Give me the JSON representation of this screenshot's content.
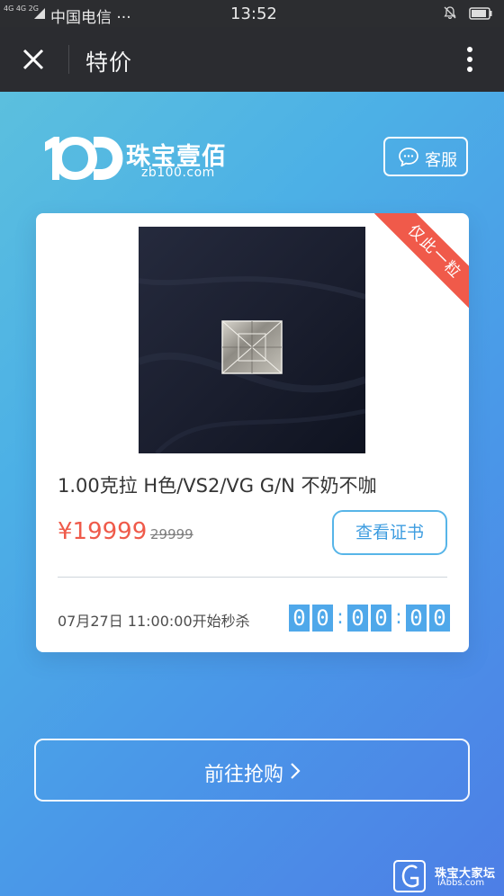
{
  "status_bar": {
    "network": "4G 4G 2G",
    "carrier": "中国电信 ···",
    "time": "13:52"
  },
  "header": {
    "title": "特价"
  },
  "brand": {
    "logo_text": "100",
    "name": "珠宝壹佰",
    "domain": "zb100.com"
  },
  "service": {
    "label": "客服"
  },
  "product": {
    "ribbon": "仅此一粒",
    "title": "1.00克拉 H色/VS2/VG G/N 不奶不咖",
    "price_current": "¥19999",
    "price_original": "29999",
    "certificate_button": "查看证书",
    "sale_start": "07月27日 11:00:00开始秒杀",
    "countdown": [
      "0",
      "0",
      "0",
      "0",
      "0",
      "0"
    ]
  },
  "buy": {
    "label": "前往抢购"
  },
  "watermark": {
    "title": "珠宝大家坛",
    "subtitle": "iAbbs.com"
  },
  "colors": {
    "accent": "#4fa8ea",
    "price": "#ef5a4a",
    "ribbon": "#f05a4a"
  }
}
